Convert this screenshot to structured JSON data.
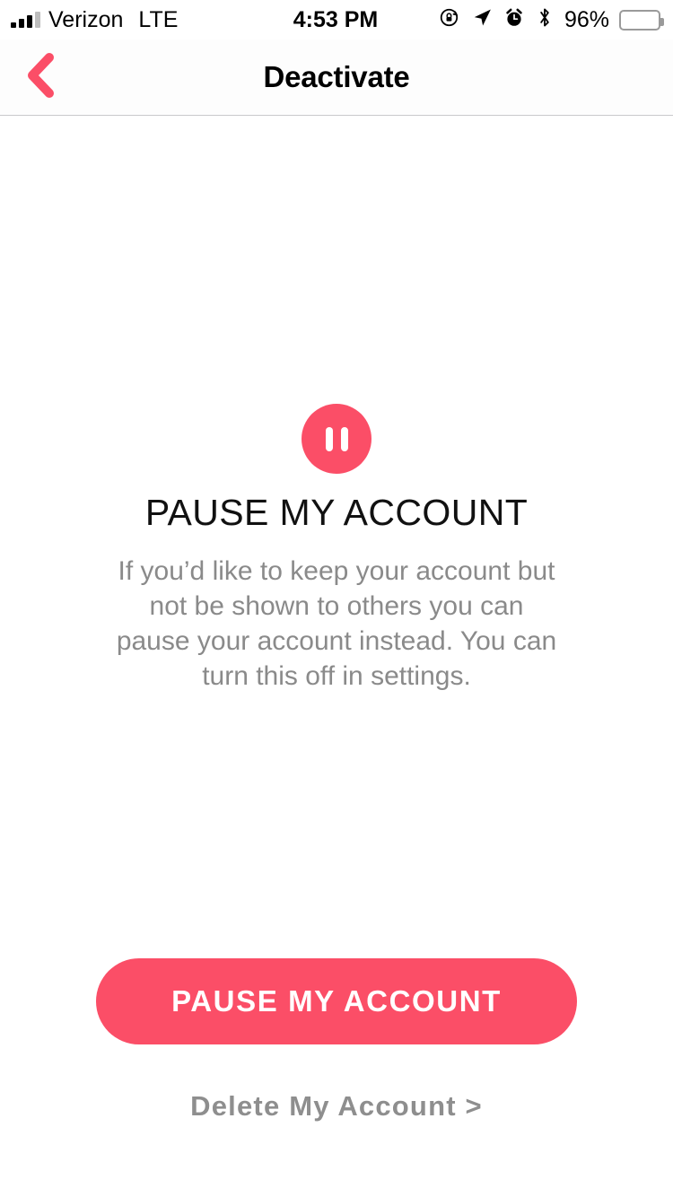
{
  "status_bar": {
    "carrier": "Verizon",
    "network_type": "LTE",
    "time": "4:53 PM",
    "battery_percent": "96%",
    "icons": [
      "signal-bars-icon",
      "rotation-lock-icon",
      "location-arrow-icon",
      "alarm-clock-icon",
      "bluetooth-icon",
      "battery-icon"
    ]
  },
  "nav_bar": {
    "title": "Deactivate",
    "back_icon": "chevron-left-icon"
  },
  "main": {
    "badge_icon": "pause-icon",
    "headline": "PAUSE MY ACCOUNT",
    "description": "If you’d like to keep your account but not be shown to others you can pause your account instead. You can turn this off in settings.",
    "primary_button_label": "PAUSE MY ACCOUNT",
    "secondary_link_label": "Delete My Account >"
  },
  "colors": {
    "accent": "#fb4e67",
    "body_text": "#8a8a8a",
    "headline_text": "#111111",
    "link_text": "#8e8e8e",
    "background": "#ffffff",
    "nav_border": "#c9c9cc"
  }
}
